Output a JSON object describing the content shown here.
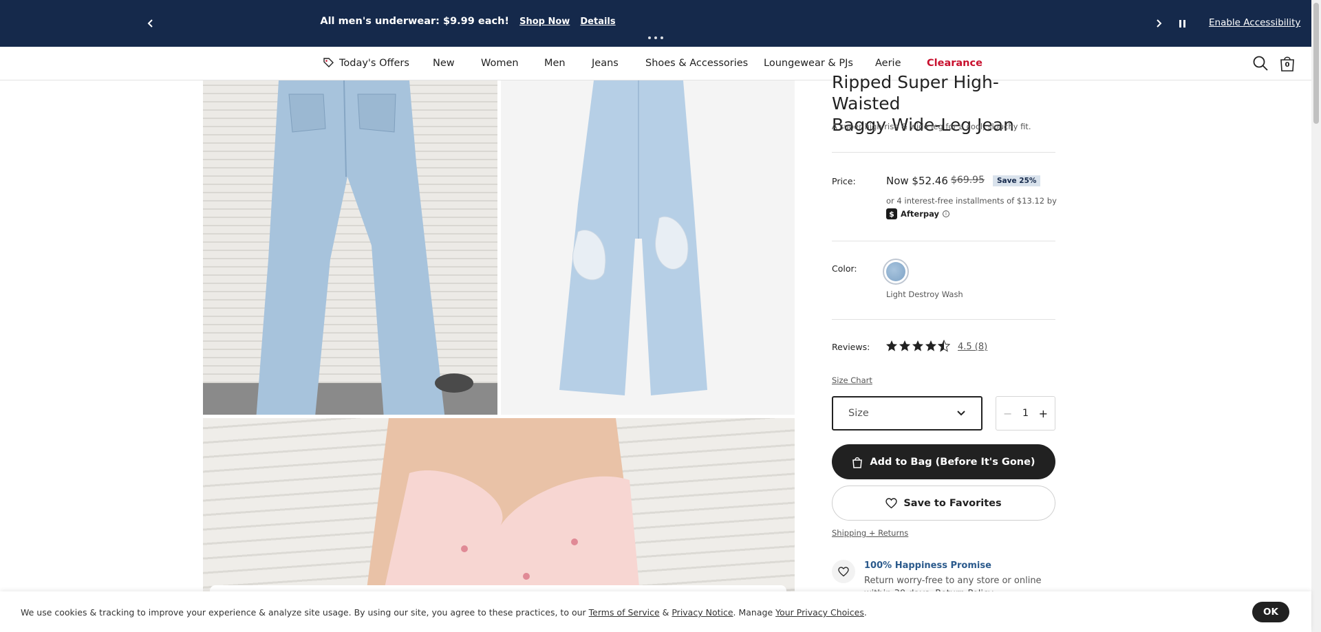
{
  "promo": {
    "message": "All men's underwear: $9.99 each!",
    "shop_now": "Shop Now",
    "details": "Details",
    "accessibility": "Enable Accessibility"
  },
  "nav": {
    "items": [
      "Today's Offers",
      "New",
      "Women",
      "Men",
      "Jeans",
      "Shoes & Accessories",
      "Loungewear & PJs",
      "Aerie",
      "Clearance"
    ],
    "bag_count": "0",
    "accent_red": "#c8102e"
  },
  "product": {
    "title_line1": "Ripped Super High-Waisted",
    "title_line2": "Baggy Wide-Leg Jean",
    "subtitle": "A super high rise & wide leg for a cool, slouchy fit.",
    "price_label": "Price:",
    "now_price": "Now $52.46",
    "was_price": "$69.95",
    "save_badge": "Save 25%",
    "installments": "or 4 interest-free installments of $13.12 by",
    "afterpay": "Afterpay",
    "afterpay_logo": "$",
    "afterpay_info": "i",
    "color_label": "Color:",
    "color_name": "Light Destroy Wash",
    "reviews_label": "Reviews:",
    "rating": 4.5,
    "rating_text": "4.5 (8)",
    "size_chart": "Size Chart",
    "size_placeholder": "Size",
    "qty_minus": "−",
    "quantity": "1",
    "qty_plus": "+",
    "add_to_bag": "Add to Bag (Before It's Gone)",
    "save_favorites": "Save to Favorites",
    "shipping_returns": "Shipping + Returns",
    "promise_title": "100% Happiness Promise",
    "promise_text": "Return worry-free to any store or online within 30 days. Return Policy"
  },
  "cookie": {
    "text_prefix": "We use cookies & tracking to improve your experience & analyze site usage. By using our site, you agree to these practices, to our ",
    "terms": "Terms of Service",
    "amp": " & ",
    "privacy": "Privacy Notice",
    "manage": ". Manage ",
    "choices": "Your Privacy Choices",
    "period": ".",
    "ok": "OK"
  },
  "colors": {
    "promo_bg": "#15294b",
    "button_dark": "#212121",
    "link_blue": "#2b5a8c"
  }
}
